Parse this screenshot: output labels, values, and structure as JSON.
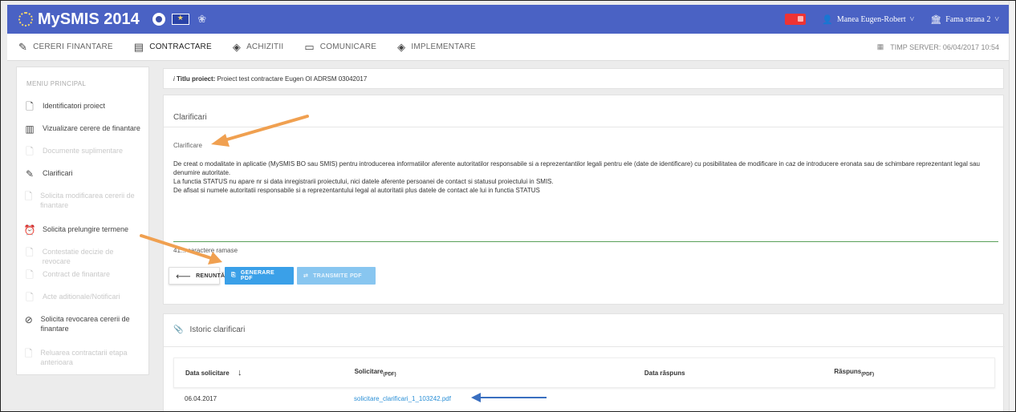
{
  "header": {
    "app_name": "MySMIS 2014",
    "user_name": "Manea Eugen-Robert",
    "user_caret": "˅",
    "institution": "Fama strana 2",
    "inst_caret": "˅"
  },
  "menu": {
    "items": [
      {
        "label": "CERERI FINANTARE",
        "icon": "pencil-icon"
      },
      {
        "label": "CONTRACTARE",
        "icon": "document-icon"
      },
      {
        "label": "ACHIZITII",
        "icon": "layers-icon"
      },
      {
        "label": "COMUNICARE",
        "icon": "monitor-icon"
      },
      {
        "label": "IMPLEMENTARE",
        "icon": "layers-icon"
      }
    ],
    "server_time": "TIMP SERVER: 06/04/2017 10:54"
  },
  "sidebar": {
    "title": "MENIU PRINCIPAL",
    "items": [
      {
        "label": "Identificatori proiect",
        "icon": "file-icon"
      },
      {
        "label": "Vizualizare cerere de finantare",
        "icon": "table-icon"
      },
      {
        "label": "Documente suplimentare",
        "icon": "file-icon"
      },
      {
        "label": "Clarificari",
        "icon": "pencil-icon"
      },
      {
        "label": "Solicita modificarea cererii de finantare",
        "icon": "file-icon"
      },
      {
        "label": "Solicita prelungire termene",
        "icon": "alarm-clock-icon"
      },
      {
        "label": "Contestatie decizie de revocare",
        "icon": "file-icon"
      },
      {
        "label": "Contract de finantare",
        "icon": "file-icon"
      },
      {
        "label": "Acte aditionale/Notificari",
        "icon": "file-icon"
      },
      {
        "label": "Solicita revocarea cererii de finantare",
        "icon": "block-icon"
      },
      {
        "label": "Reluarea contractarii etapa anterioara",
        "icon": "file-icon"
      }
    ]
  },
  "project": {
    "title_label": "Titlu proiect:",
    "title_value": "Proiect test contractare Eugen OI ADRSM 03042017"
  },
  "clarificari": {
    "header": "Clarificari",
    "field_label": "Clarificare",
    "text_lines": [
      "De creat o modalitate in aplicatie (MySMIS BO sau SMIS) pentru introducerea informatiilor aferente autoritatilor responsabile si a reprezentantilor legali pentru ele (date de identificare) cu posibilitatea de modificare in caz de introducere eronata sau de schimbare reprezentant legal sau denumire autoritate.",
      "La functia STATUS nu apare nr si data inregistrarii proiectului, nici datele aferente persoanei de contact si statusul proiectului in SMIS.",
      "De afisat si numele autoritatii responsabile si a reprezentantului legal al autoritatii plus datele de contact ale lui in functia STATUS"
    ],
    "char_count": "41... caractere ramase",
    "buttons": {
      "back": "RENUNTĂ",
      "generate": "GENERARE PDF",
      "send": "TRANSMITE PDF"
    }
  },
  "istoric": {
    "header": "Istoric clarificari",
    "columns": [
      "Data solicitare",
      "Solicitare",
      "Data răspuns",
      "Răspuns"
    ],
    "pdf_tag": "(PDF)",
    "rows": [
      {
        "date": "06.04.2017",
        "file": "solicitare_clarificari_1_103242.pdf",
        "reply_date": "",
        "reply": ""
      }
    ]
  },
  "colors": {
    "topbar": "#4a62c4",
    "accent": "#3aa0e8",
    "arrow_orange": "#f0a050",
    "arrow_blue": "#3a6fc0"
  }
}
